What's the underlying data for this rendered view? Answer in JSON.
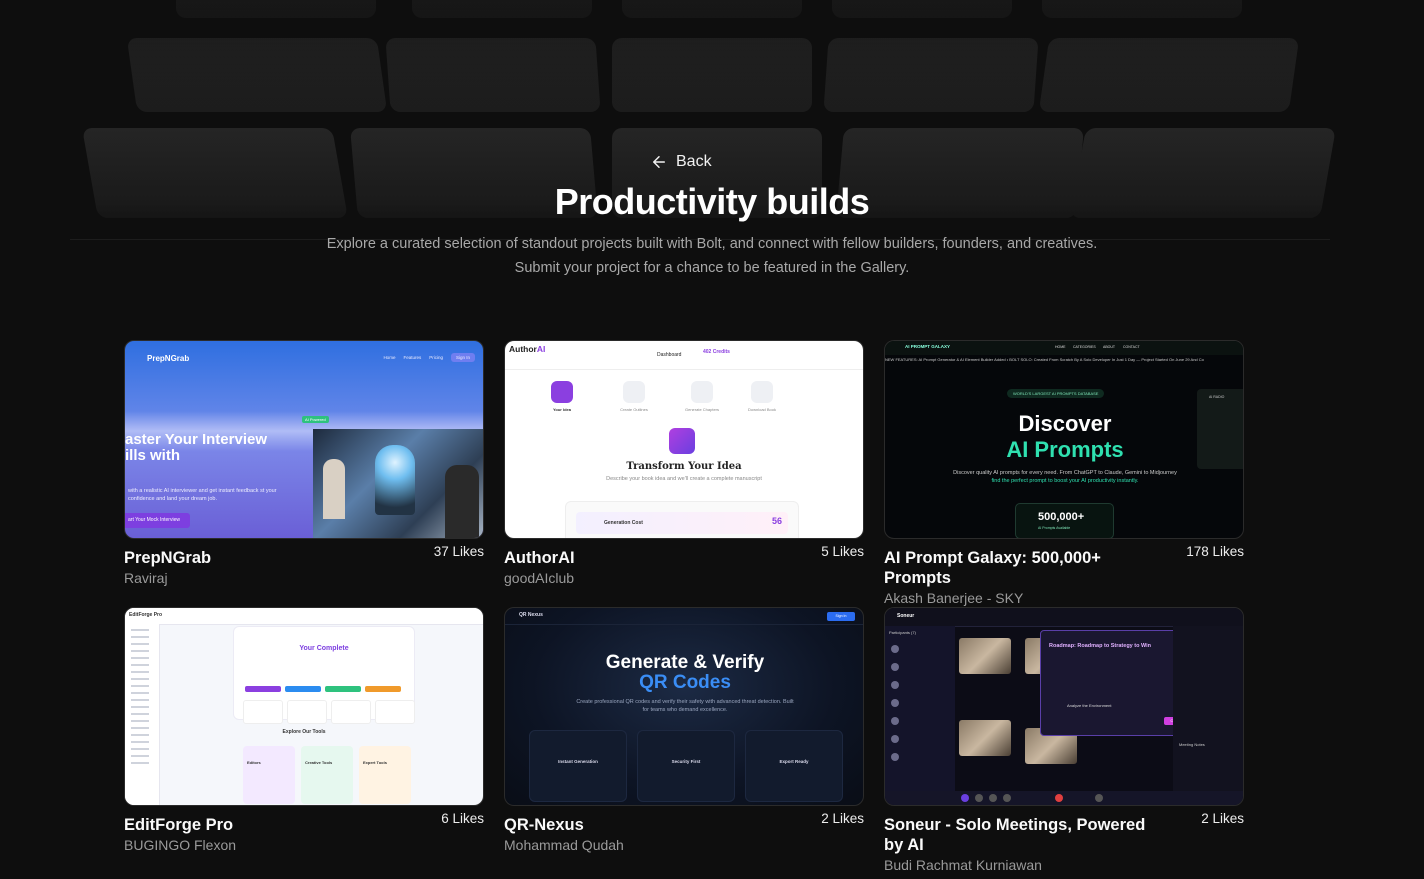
{
  "header": {
    "back_label": "Back",
    "title": "Productivity builds",
    "subtitle": "Explore a curated selection of standout projects built with Bolt, and connect with fellow builders, founders, and creatives. Submit your project for a chance to be featured in the Gallery."
  },
  "projects": [
    {
      "title": "PrepNGrab",
      "author": "Raviraj",
      "likes": "37 Likes",
      "thumb": {
        "logo": "PrepNGrab",
        "nav": [
          "Home",
          "Features",
          "Pricing",
          "Sign In"
        ],
        "headline_1": "aster Your Interview",
        "headline_2": "ills with",
        "desc": "with a realistic AI interviewer and get instant feedback st your confidence and land your dream job.",
        "cta": "art Your Mock Interview",
        "badge": "AI Powered"
      }
    },
    {
      "title": "AuthorAI",
      "author": "goodAIclub",
      "likes": "5 Likes",
      "thumb": {
        "logo_a": "Author",
        "logo_b": "AI",
        "nav": [
          "Dashboard",
          "402 Credits"
        ],
        "steps": [
          "Your Idea",
          "Create Outlines",
          "Generate Chapters",
          "Download Book"
        ],
        "heading": "Transform Your Idea",
        "sub": "Describe your book idea and we'll create a complete manuscript",
        "cost_label": "Generation Cost",
        "cost_value": "56"
      }
    },
    {
      "title": "AI Prompt Galaxy: 500,000+ Prompts",
      "author": "Akash Banerjee - SKY",
      "likes": "178 Likes",
      "thumb": {
        "brand": "AI PROMPT GALAXY",
        "nav": [
          "HOME",
          "CATEGORIES",
          "ABOUT",
          "CONTACT"
        ],
        "marquee": "NEW FEATURES: AI Prompt Generator & AI Element Builder Added • BOLT SOLO: Created From Scratch By A Solo Developer In Just 1 Day — Project Started On June 29 And Co",
        "pill": "WORLD'S LARGEST AI PROMPTS DATABASE",
        "heading_1": "Discover",
        "heading_2": "AI Prompts",
        "desc_1": "Discover quality AI prompts for every need. From ChatGPT to Claude, Gemini to Midjourney",
        "desc_2": "find the perfect prompt to boost your AI productivity instantly.",
        "count": "500,000+",
        "count_label": "AI Prompts Available",
        "widget": "AI RADIO"
      }
    },
    {
      "title": "EditForge Pro",
      "author": "BUGINGO Flexon",
      "likes": "6 Likes",
      "thumb": {
        "logo": "EditForge Pro",
        "heading": "Your Complete",
        "stats": [
          "25+",
          "0",
          "Unlimited",
          "100%"
        ],
        "section": "Explore Our Tools",
        "tools": [
          "Editors",
          "Creative Tools",
          "Expert Tools"
        ]
      }
    },
    {
      "title": "QR-Nexus",
      "author": "Mohammad Qudah",
      "likes": "2 Likes",
      "thumb": {
        "logo": "QR Nexus",
        "sign_in": "Sign In",
        "heading_1": "Generate & Verify",
        "heading_2": "QR Codes",
        "desc": "Create professional QR codes and verify their safety with advanced threat detection. Built for teams who demand excellence.",
        "features": [
          "Instant Generation",
          "Security First",
          "Export Ready"
        ]
      }
    },
    {
      "title": "Soneur - Solo Meetings, Powered by AI",
      "author": "Budi Rachmat Kurniawan",
      "likes": "2 Likes",
      "thumb": {
        "logo": "Soneur",
        "panel": "Participants (7)",
        "modal_title": "Roadmap: Roadmap to Strategy to Win",
        "step": "Analyze the Environment",
        "close": "Close",
        "meeting": "Meeting Notes"
      }
    }
  ],
  "colors": {
    "background": "#0e0e0e",
    "subtitle": "#a8a8a8",
    "author": "#9a9a9a"
  },
  "icons": {
    "back": "arrow-left-icon"
  }
}
